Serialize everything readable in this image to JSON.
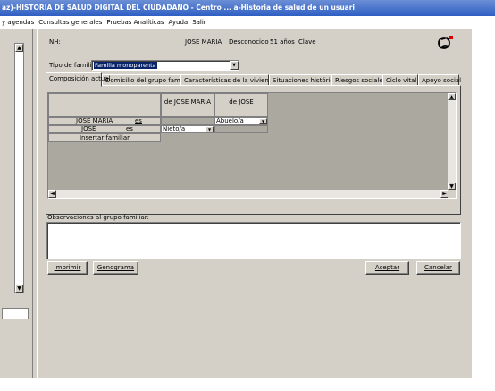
{
  "window": {
    "title": "az)-HISTORIA DE SALUD DIGITAL  DEL CIUDADANO - Centro ... a-Historia de salud de un usuari"
  },
  "menu": {
    "items": [
      "y agendas",
      "Consultas generales",
      "Pruebas Analíticas",
      "Ayuda",
      "Salir"
    ]
  },
  "patient": {
    "nh_label": "NH:",
    "name": "JOSE MARIA",
    "status": "Desconocido",
    "age": "51 años",
    "clave_label": "Clave"
  },
  "family_type": {
    "label": "Tipo de familia:",
    "value": "Familia monoparenta"
  },
  "tabs": [
    {
      "label": "Composición actual",
      "active": true
    },
    {
      "label": "Domicilio del grupo familiar",
      "active": false
    },
    {
      "label": "Características de la vivienda",
      "active": false
    },
    {
      "label": "Situaciones históricas",
      "active": false
    },
    {
      "label": "Riesgos sociales",
      "active": false
    },
    {
      "label": "Ciclo vital",
      "active": false
    },
    {
      "label": "Apoyo social",
      "active": false
    }
  ],
  "grid": {
    "col_headers": [
      "de JOSE MARIA",
      "de JOSE"
    ],
    "rows": [
      {
        "name": "JOSE MARIA",
        "connector": "es",
        "rel1": "",
        "rel2": "Abuelo/a"
      },
      {
        "name": "JOSE",
        "connector": "es",
        "rel1": "Nieto/a",
        "rel2": ""
      }
    ],
    "insert_label": "Insertar familiar"
  },
  "observations": {
    "label": "Observaciones al grupo familiar:",
    "value": ""
  },
  "buttons": {
    "imprimir": "Imprimir",
    "genograma": "Genograma",
    "aceptar": "Aceptar",
    "cancelar": "Cancelar"
  },
  "icons": {
    "doctor": "doctor-avatar-icon"
  },
  "colors": {
    "titlebar": "#2f5fc4",
    "face": "#d4d0c8",
    "grid_bg": "#aba8a0",
    "selection": "#0a246a"
  }
}
